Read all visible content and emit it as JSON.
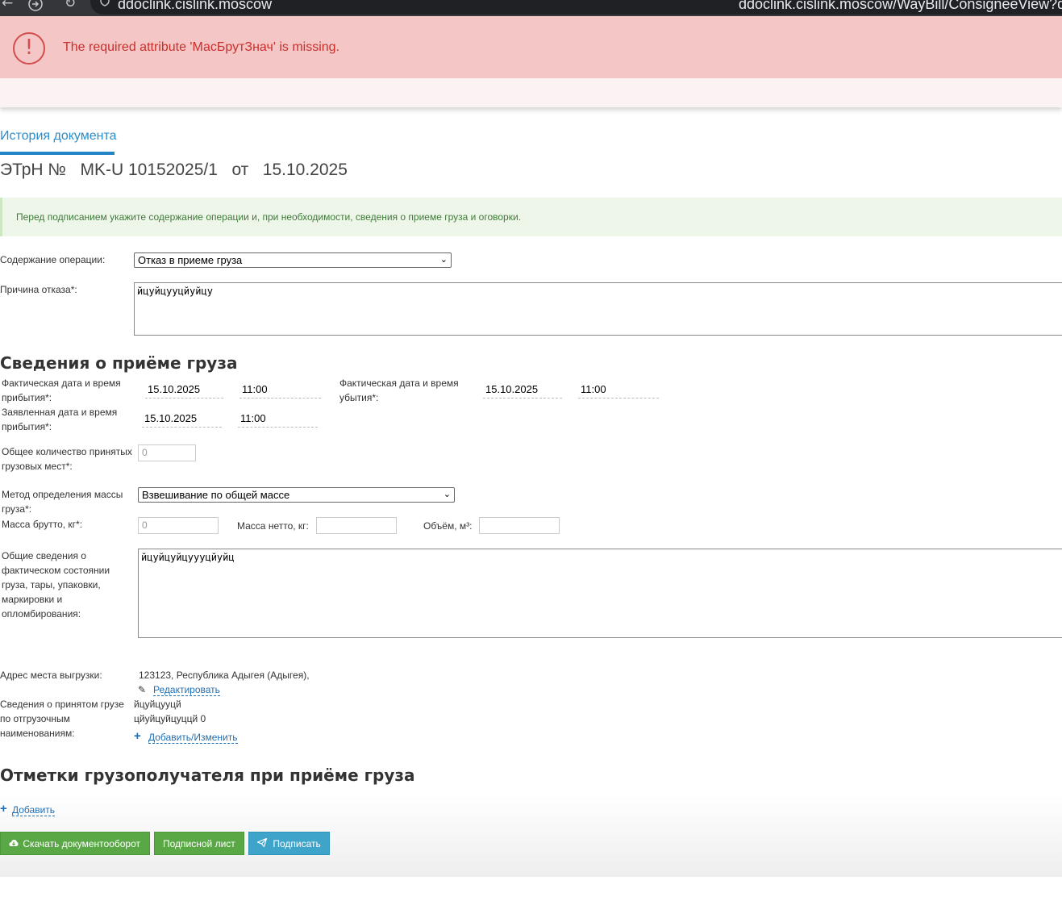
{
  "browser": {
    "back_icon": "←",
    "forward_icon": "→",
    "reload_icon": "↻",
    "shield_icon": "shield-icon",
    "url_host": "ddoclink.cislink.moscow",
    "url_full": "ddoclink.cislink.moscow/WayBill/ConsigneeView?docid="
  },
  "error": {
    "icon": "!",
    "message": "The required attribute 'МасБрутЗнач' is missing."
  },
  "tabs": {
    "history": "История документа"
  },
  "document": {
    "prefix": "ЭТрН №",
    "number": "MK-U 10152025/1",
    "from": "от",
    "date": "15.10.2025"
  },
  "info_text": "Перед подписанием укажите содержание операции и, при необходимости, сведения о приеме груза и оговорки.",
  "operation": {
    "label": "Содержание операции:",
    "value": "Отказ в приеме груза"
  },
  "reject": {
    "label": "Причина отказа*:",
    "value": "йцуйцууцйуйцу"
  },
  "cargo": {
    "heading": "Сведения о приёме груза",
    "actual_arrival_label": "Фактическая дата и время прибытия*:",
    "actual_arrival_date": "15.10.2025",
    "actual_arrival_time": "11:00",
    "actual_departure_label": "Фактическая дата и время убытия*:",
    "actual_departure_date": "15.10.2025",
    "actual_departure_time": "11:00",
    "declared_arrival_label": "Заявленная дата и время прибытия*:",
    "declared_arrival_date": "15.10.2025",
    "declared_arrival_time": "11:00",
    "places_label": "Общее количество принятых грузовых мест*:",
    "places_value": "0",
    "mass_method_label": "Метод определения массы груза*:",
    "mass_method_value": "Взвешивание по общей массе",
    "gross_label": "Масса брутто, кг*:",
    "gross_value": "0",
    "net_label": "Масса нетто, кг:",
    "net_value": "",
    "volume_label": "Объём, м³:",
    "volume_value": "",
    "condition_label": "Общие сведения о фактическом состоянии груза, тары, упаковки, маркировки и опломбирования:",
    "condition_value": "йцуйцуйцуууцйуйц",
    "address_label": "Адрес места выгрузки:",
    "address_value": "123123, Республика Адыгея (Адыгея),",
    "edit_link": "Редактировать",
    "items_label": "Сведения о принятом грузе по отгрузочным наименованиям:",
    "item_line1": "йцуйцууцй",
    "item_line2": "цйуйцуйцуццй 0",
    "add_change_link": "Добавить/Изменить"
  },
  "marks": {
    "heading": "Отметки грузополучателя при приёме груза",
    "add_link": "Добавить"
  },
  "buttons": {
    "download": "Скачать документооборот",
    "signature_sheet": "Подписной лист",
    "sign": "Подписать"
  }
}
